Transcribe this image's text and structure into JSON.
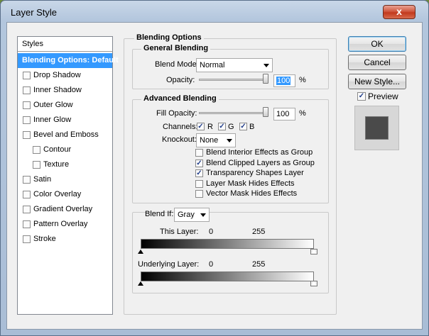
{
  "window": {
    "title": "Layer Style",
    "close_label": "x"
  },
  "styles_list": {
    "header": "Styles",
    "items": [
      {
        "label": "Blending Options: Default",
        "selected": true,
        "checkbox": false,
        "indent": 0
      },
      {
        "label": "Drop Shadow",
        "checkbox": true,
        "indent": 0
      },
      {
        "label": "Inner Shadow",
        "checkbox": true,
        "indent": 0
      },
      {
        "label": "Outer Glow",
        "checkbox": true,
        "indent": 0
      },
      {
        "label": "Inner Glow",
        "checkbox": true,
        "indent": 0
      },
      {
        "label": "Bevel and Emboss",
        "checkbox": true,
        "indent": 0
      },
      {
        "label": "Contour",
        "checkbox": true,
        "indent": 1
      },
      {
        "label": "Texture",
        "checkbox": true,
        "indent": 1
      },
      {
        "label": "Satin",
        "checkbox": true,
        "indent": 0
      },
      {
        "label": "Color Overlay",
        "checkbox": true,
        "indent": 0
      },
      {
        "label": "Gradient Overlay",
        "checkbox": true,
        "indent": 0
      },
      {
        "label": "Pattern Overlay",
        "checkbox": true,
        "indent": 0
      },
      {
        "label": "Stroke",
        "checkbox": true,
        "indent": 0
      }
    ]
  },
  "blending_options": {
    "title": "Blending Options",
    "general": {
      "title": "General Blending",
      "blend_mode_label": "Blend Mode:",
      "blend_mode_value": "Normal",
      "opacity_label": "Opacity:",
      "opacity_value": "100",
      "opacity_unit": "%"
    },
    "advanced": {
      "title": "Advanced Blending",
      "fill_opacity_label": "Fill Opacity:",
      "fill_opacity_value": "100",
      "fill_opacity_unit": "%",
      "channels_label": "Channels:",
      "channel_r": "R",
      "channel_g": "G",
      "channel_b": "B",
      "knockout_label": "Knockout:",
      "knockout_value": "None",
      "options": [
        {
          "label": "Blend Interior Effects as Group",
          "checked": false
        },
        {
          "label": "Blend Clipped Layers as Group",
          "checked": true
        },
        {
          "label": "Transparency Shapes Layer",
          "checked": true
        },
        {
          "label": "Layer Mask Hides Effects",
          "checked": false
        },
        {
          "label": "Vector Mask Hides Effects",
          "checked": false
        }
      ]
    },
    "blend_if": {
      "label": "Blend If:",
      "value": "Gray",
      "this_layer_label": "This Layer:",
      "this_layer_min": "0",
      "this_layer_max": "255",
      "underlying_label": "Underlying Layer:",
      "underlying_min": "0",
      "underlying_max": "255"
    }
  },
  "buttons": {
    "ok": "OK",
    "cancel": "Cancel",
    "new_style": "New Style...",
    "preview_label": "Preview"
  }
}
